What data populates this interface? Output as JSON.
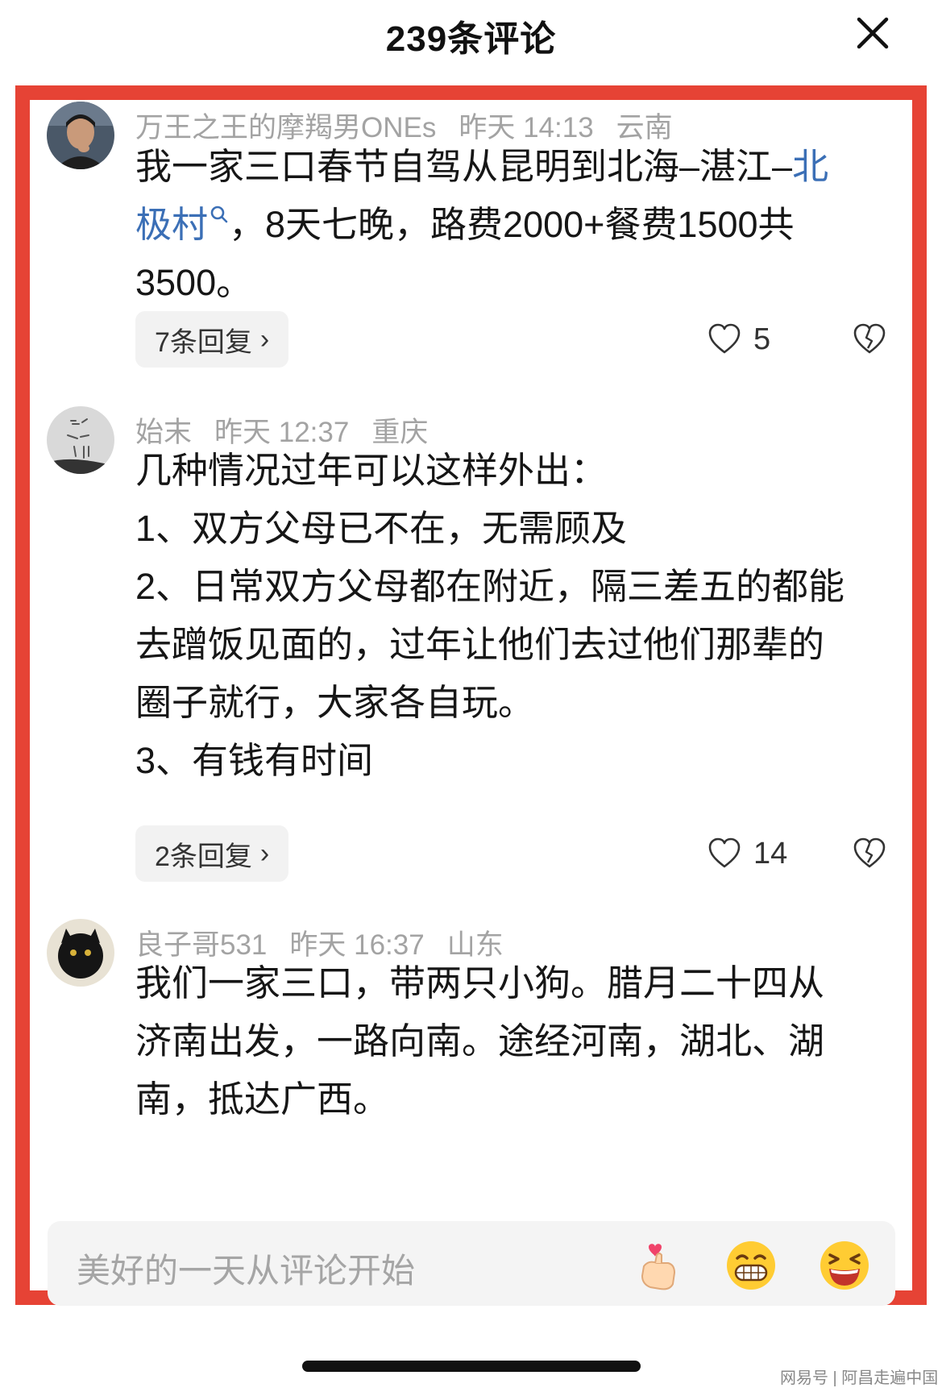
{
  "header": {
    "title": "239条评论"
  },
  "comments": [
    {
      "username": "万王之王的摩羯男ONEs",
      "time": "昨天 14:13",
      "location": "云南",
      "text_line1": "我一家三口春节自驾从昆明到北海–湛江–",
      "link_text_part1": "北",
      "link_text_part2": "极村",
      "text_line2_rest": "，8天七晚，路费2000+餐费1500共",
      "text_line3": "3500。",
      "replies_label": "7条回复",
      "likes": "5"
    },
    {
      "username": "始末",
      "time": "昨天 12:37",
      "location": "重庆",
      "lines": [
        "几种情况过年可以这样外出：",
        "1、双方父母已不在，无需顾及",
        "2、日常双方父母都在附近，隔三差五的都能",
        "去蹭饭见面的，过年让他们去过他们那辈的",
        "圈子就行，大家各自玩。",
        "3、有钱有时间"
      ],
      "replies_label": "2条回复",
      "likes": "14"
    },
    {
      "username": "良子哥531",
      "time": "昨天 16:37",
      "location": "山东",
      "lines": [
        "我们一家三口，带两只小狗。腊月二十四从",
        "济南出发，一路向南。途经河南，湖北、湖",
        "南，抵达广西。"
      ]
    }
  ],
  "input": {
    "placeholder": "美好的一天从评论开始"
  },
  "emojis": [
    "finger-heart-emoji",
    "grinning-emoji",
    "laughing-emoji"
  ],
  "watermark": "网易号 | 阿昌走遍中国",
  "colors": {
    "frame": "#e64335",
    "link": "#3b6fb6",
    "meta": "#a3a3a3"
  }
}
